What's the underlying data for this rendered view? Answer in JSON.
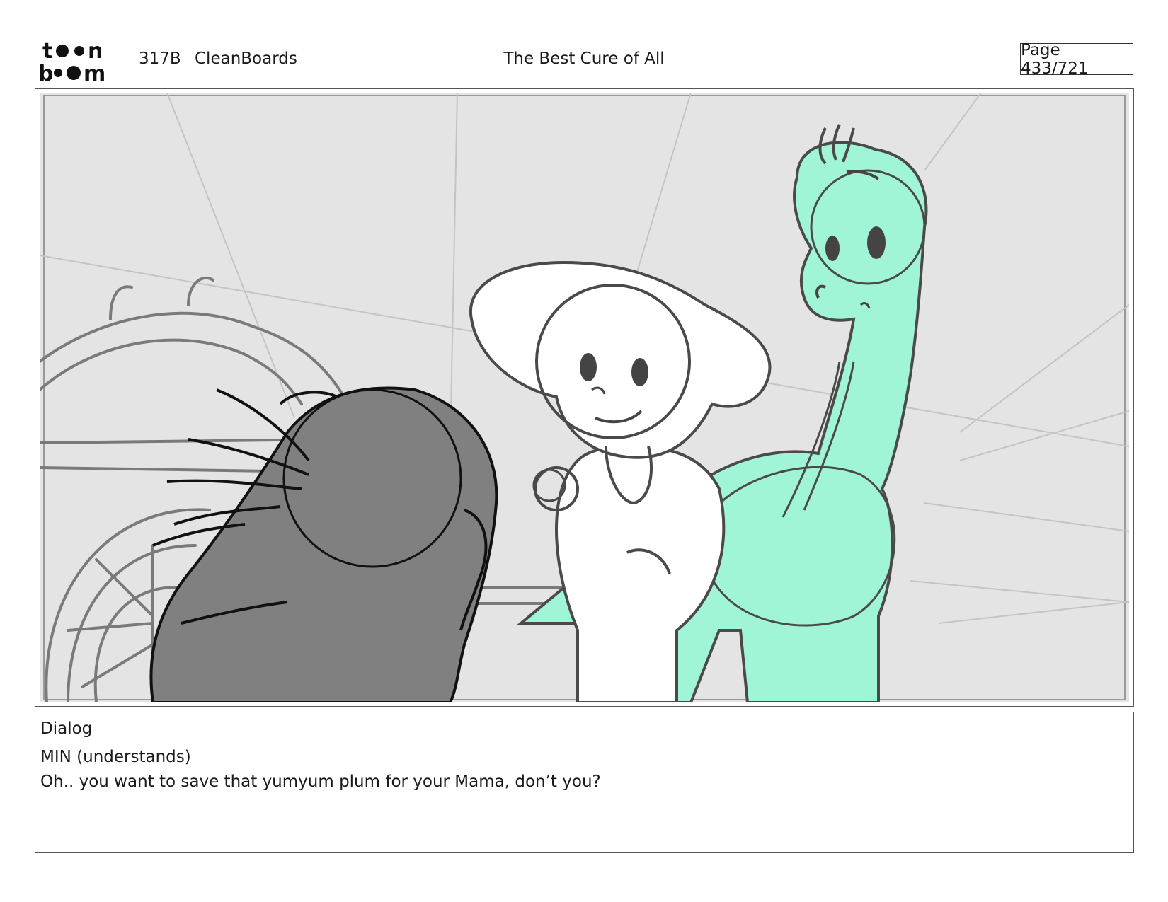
{
  "header": {
    "logo_text": "toon boom",
    "episode": "317B",
    "section": "CleanBoards",
    "title": "The Best Cure of All",
    "page": "Page 433/721"
  },
  "panel": {
    "background": "#e4e4e4",
    "dino_color": "#a0f5d6",
    "ink_color": "#3a3a3a",
    "shadow_color": "#808080"
  },
  "dialog": {
    "heading": "Dialog",
    "speaker": "MIN (understands)",
    "line": "Oh.. you want to save that yumyum plum for your Mama, don’t you?"
  }
}
